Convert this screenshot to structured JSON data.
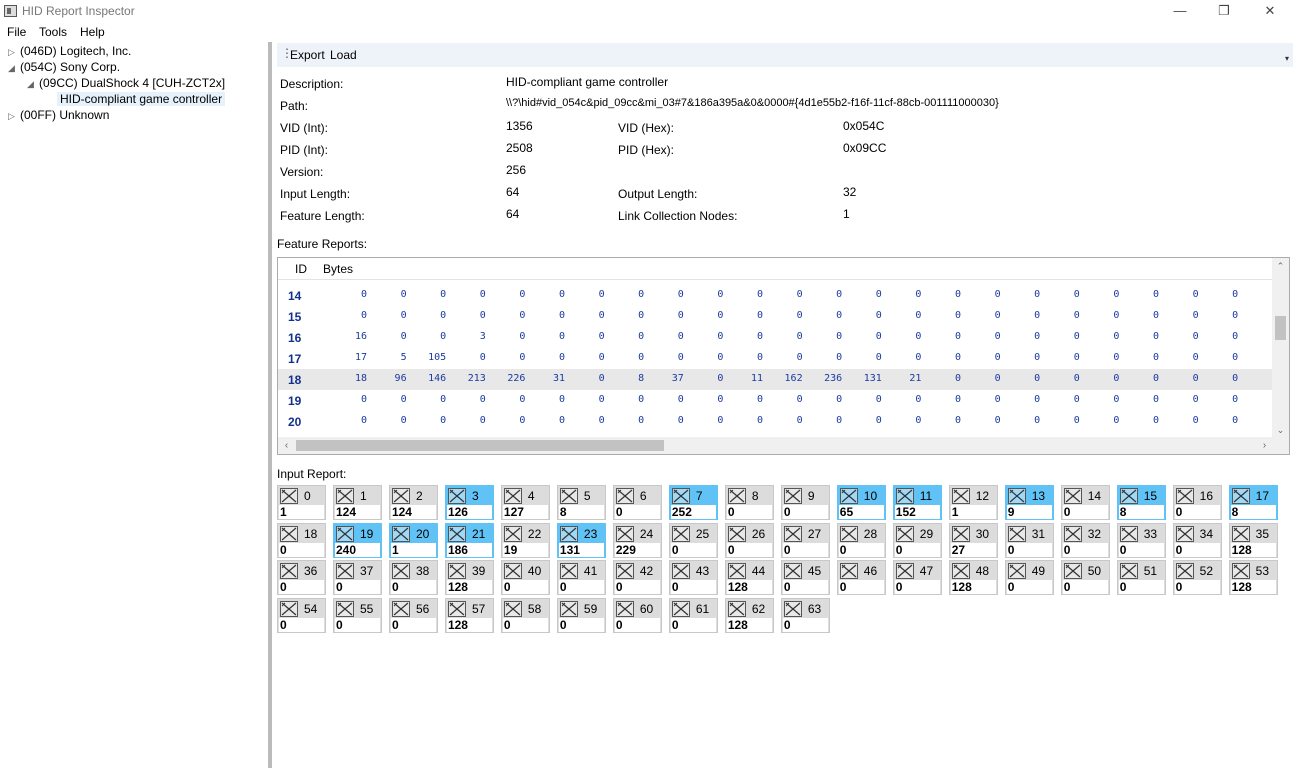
{
  "window": {
    "title": "HID Report Inspector",
    "minimize": "—",
    "restore": "❐",
    "close": "✕"
  },
  "menu": [
    "File",
    "Tools",
    "Help"
  ],
  "tree": [
    {
      "label": "(046D) Logitech, Inc.",
      "arrow": "▷"
    },
    {
      "label": "(054C) Sony Corp.",
      "arrow": "◢"
    },
    {
      "label": "(09CC) DualShock 4 [CUH-ZCT2x]",
      "arrow": "◢"
    },
    {
      "label": "HID-compliant game controller",
      "arrow": ""
    },
    {
      "label": "(00FF) Unknown",
      "arrow": "▷"
    }
  ],
  "toolbar": {
    "grip": "⋮",
    "export": "Export",
    "load": "Load",
    "overflow": "▾"
  },
  "info": {
    "description_label": "Description:",
    "description": "HID-compliant game controller",
    "path_label": "Path:",
    "path": "\\\\?\\hid#vid_054c&pid_09cc&mi_03#7&186a395a&0&0000#{4d1e55b2-f16f-11cf-88cb-001111000030}",
    "vid_int_label": "VID (Int):",
    "vid_int": "1356",
    "vid_hex_label": "VID (Hex):",
    "vid_hex": "0x054C",
    "pid_int_label": "PID (Int):",
    "pid_int": "2508",
    "pid_hex_label": "PID (Hex):",
    "pid_hex": "0x09CC",
    "version_label": "Version:",
    "version": "256",
    "input_length_label": "Input Length:",
    "input_length": "64",
    "output_length_label": "Output Length:",
    "output_length": "32",
    "feature_length_label": "Feature Length:",
    "feature_length": "64",
    "link_nodes_label": "Link Collection Nodes:",
    "link_nodes": "1"
  },
  "feature": {
    "title": "Feature Reports:",
    "col_id": "ID",
    "col_bytes": "Bytes",
    "selected_row": 4,
    "rows": [
      {
        "id": "14",
        "bytes": [
          "0",
          "0",
          "0",
          "0",
          "0",
          "0",
          "0",
          "0",
          "0",
          "0",
          "0",
          "0",
          "0",
          "0",
          "0",
          "0",
          "0",
          "0",
          "0",
          "0",
          "0",
          "0",
          "0"
        ]
      },
      {
        "id": "15",
        "bytes": [
          "0",
          "0",
          "0",
          "0",
          "0",
          "0",
          "0",
          "0",
          "0",
          "0",
          "0",
          "0",
          "0",
          "0",
          "0",
          "0",
          "0",
          "0",
          "0",
          "0",
          "0",
          "0",
          "0"
        ]
      },
      {
        "id": "16",
        "bytes": [
          "16",
          "0",
          "0",
          "3",
          "0",
          "0",
          "0",
          "0",
          "0",
          "0",
          "0",
          "0",
          "0",
          "0",
          "0",
          "0",
          "0",
          "0",
          "0",
          "0",
          "0",
          "0",
          "0"
        ]
      },
      {
        "id": "17",
        "bytes": [
          "17",
          "5",
          "105",
          "0",
          "0",
          "0",
          "0",
          "0",
          "0",
          "0",
          "0",
          "0",
          "0",
          "0",
          "0",
          "0",
          "0",
          "0",
          "0",
          "0",
          "0",
          "0",
          "0"
        ]
      },
      {
        "id": "18",
        "bytes": [
          "18",
          "96",
          "146",
          "213",
          "226",
          "31",
          "0",
          "8",
          "37",
          "0",
          "11",
          "162",
          "236",
          "131",
          "21",
          "0",
          "0",
          "0",
          "0",
          "0",
          "0",
          "0",
          "0"
        ]
      },
      {
        "id": "19",
        "bytes": [
          "0",
          "0",
          "0",
          "0",
          "0",
          "0",
          "0",
          "0",
          "0",
          "0",
          "0",
          "0",
          "0",
          "0",
          "0",
          "0",
          "0",
          "0",
          "0",
          "0",
          "0",
          "0",
          "0"
        ]
      },
      {
        "id": "20",
        "bytes": [
          "0",
          "0",
          "0",
          "0",
          "0",
          "0",
          "0",
          "0",
          "0",
          "0",
          "0",
          "0",
          "0",
          "0",
          "0",
          "0",
          "0",
          "0",
          "0",
          "0",
          "0",
          "0",
          "0"
        ]
      }
    ],
    "scroll_up": "⌃",
    "scroll_down": "⌄",
    "scroll_left": "‹",
    "scroll_right": "›"
  },
  "input": {
    "title": "Input Report:",
    "highlight_color": "#61C3F5",
    "bytes": [
      {
        "i": "0",
        "v": "1",
        "on": false
      },
      {
        "i": "1",
        "v": "124",
        "on": false
      },
      {
        "i": "2",
        "v": "124",
        "on": false
      },
      {
        "i": "3",
        "v": "126",
        "on": true
      },
      {
        "i": "4",
        "v": "127",
        "on": false
      },
      {
        "i": "5",
        "v": "8",
        "on": false
      },
      {
        "i": "6",
        "v": "0",
        "on": false
      },
      {
        "i": "7",
        "v": "252",
        "on": true
      },
      {
        "i": "8",
        "v": "0",
        "on": false
      },
      {
        "i": "9",
        "v": "0",
        "on": false
      },
      {
        "i": "10",
        "v": "65",
        "on": true
      },
      {
        "i": "11",
        "v": "152",
        "on": true
      },
      {
        "i": "12",
        "v": "1",
        "on": false
      },
      {
        "i": "13",
        "v": "9",
        "on": true
      },
      {
        "i": "14",
        "v": "0",
        "on": false
      },
      {
        "i": "15",
        "v": "8",
        "on": true
      },
      {
        "i": "16",
        "v": "0",
        "on": false
      },
      {
        "i": "17",
        "v": "8",
        "on": true
      },
      {
        "i": "18",
        "v": "0",
        "on": false
      },
      {
        "i": "19",
        "v": "240",
        "on": true
      },
      {
        "i": "20",
        "v": "1",
        "on": true
      },
      {
        "i": "21",
        "v": "186",
        "on": true
      },
      {
        "i": "22",
        "v": "19",
        "on": false
      },
      {
        "i": "23",
        "v": "131",
        "on": true
      },
      {
        "i": "24",
        "v": "229",
        "on": false
      },
      {
        "i": "25",
        "v": "0",
        "on": false
      },
      {
        "i": "26",
        "v": "0",
        "on": false
      },
      {
        "i": "27",
        "v": "0",
        "on": false
      },
      {
        "i": "28",
        "v": "0",
        "on": false
      },
      {
        "i": "29",
        "v": "0",
        "on": false
      },
      {
        "i": "30",
        "v": "27",
        "on": false
      },
      {
        "i": "31",
        "v": "0",
        "on": false
      },
      {
        "i": "32",
        "v": "0",
        "on": false
      },
      {
        "i": "33",
        "v": "0",
        "on": false
      },
      {
        "i": "34",
        "v": "0",
        "on": false
      },
      {
        "i": "35",
        "v": "128",
        "on": false
      },
      {
        "i": "36",
        "v": "0",
        "on": false
      },
      {
        "i": "37",
        "v": "0",
        "on": false
      },
      {
        "i": "38",
        "v": "0",
        "on": false
      },
      {
        "i": "39",
        "v": "128",
        "on": false
      },
      {
        "i": "40",
        "v": "0",
        "on": false
      },
      {
        "i": "41",
        "v": "0",
        "on": false
      },
      {
        "i": "42",
        "v": "0",
        "on": false
      },
      {
        "i": "43",
        "v": "0",
        "on": false
      },
      {
        "i": "44",
        "v": "128",
        "on": false
      },
      {
        "i": "45",
        "v": "0",
        "on": false
      },
      {
        "i": "46",
        "v": "0",
        "on": false
      },
      {
        "i": "47",
        "v": "0",
        "on": false
      },
      {
        "i": "48",
        "v": "128",
        "on": false
      },
      {
        "i": "49",
        "v": "0",
        "on": false
      },
      {
        "i": "50",
        "v": "0",
        "on": false
      },
      {
        "i": "51",
        "v": "0",
        "on": false
      },
      {
        "i": "52",
        "v": "0",
        "on": false
      },
      {
        "i": "53",
        "v": "128",
        "on": false
      },
      {
        "i": "54",
        "v": "0",
        "on": false
      },
      {
        "i": "55",
        "v": "0",
        "on": false
      },
      {
        "i": "56",
        "v": "0",
        "on": false
      },
      {
        "i": "57",
        "v": "128",
        "on": false
      },
      {
        "i": "58",
        "v": "0",
        "on": false
      },
      {
        "i": "59",
        "v": "0",
        "on": false
      },
      {
        "i": "60",
        "v": "0",
        "on": false
      },
      {
        "i": "61",
        "v": "0",
        "on": false
      },
      {
        "i": "62",
        "v": "128",
        "on": false
      },
      {
        "i": "63",
        "v": "0",
        "on": false
      }
    ]
  }
}
